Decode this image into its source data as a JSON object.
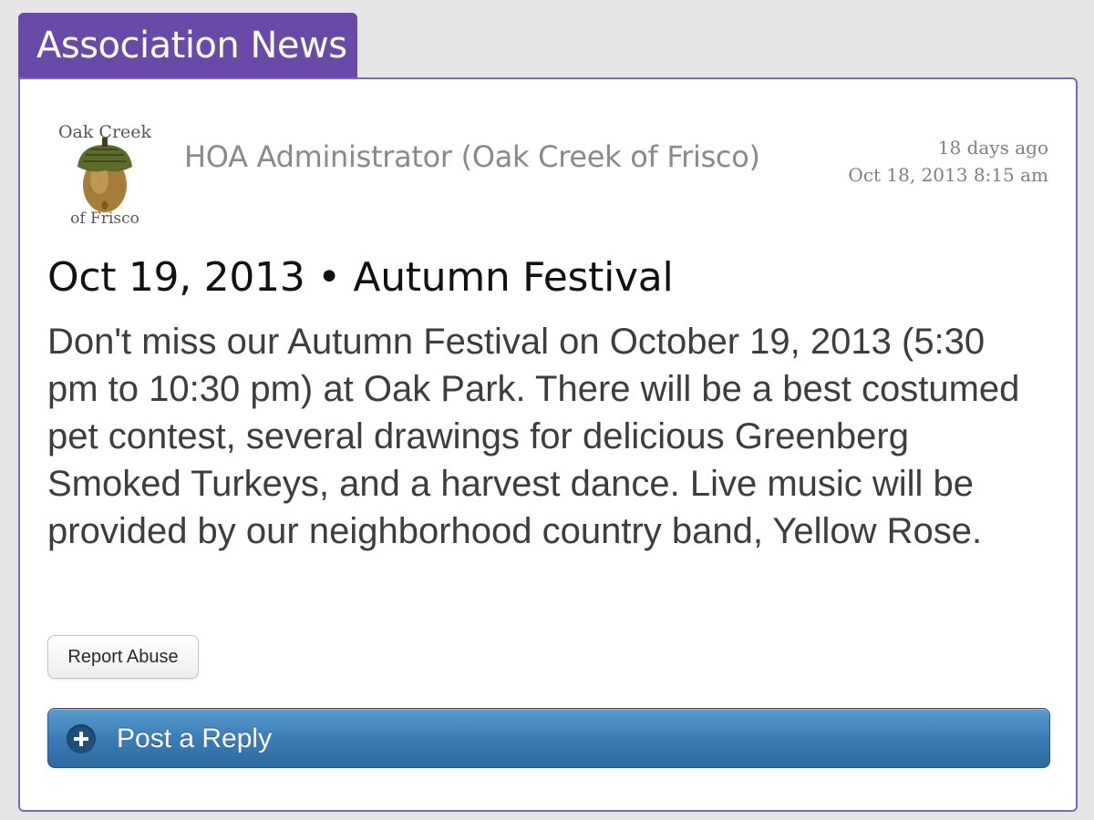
{
  "section": {
    "title": "Association News"
  },
  "post": {
    "logo": {
      "text_top": "Oak Creek",
      "text_bottom": "of Frisco",
      "icon": "acorn-icon"
    },
    "author": "HOA Administrator (Oak Creek of Frisco)",
    "relative_time": "18 days ago",
    "timestamp": "Oct 18, 2013 8:15 am",
    "headline": "Oct 19, 2013 • Autumn Festival",
    "body": "Don't miss our Autumn Festival on October 19, 2013 (5:30 pm to 10:30 pm) at Oak Park. There will be a best costumed pet contest, several drawings for delicious Greenberg Smoked Turkeys, and a harvest dance. Live music will be provided by our neighborhood country band, Yellow Rose."
  },
  "actions": {
    "report_label": "Report Abuse",
    "reply_label": "Post a Reply",
    "reply_icon": "plus-circle-icon"
  },
  "colors": {
    "tab_purple": "#6a4aa8",
    "panel_border": "#7a68b8",
    "reply_blue": "#3b7db6"
  }
}
